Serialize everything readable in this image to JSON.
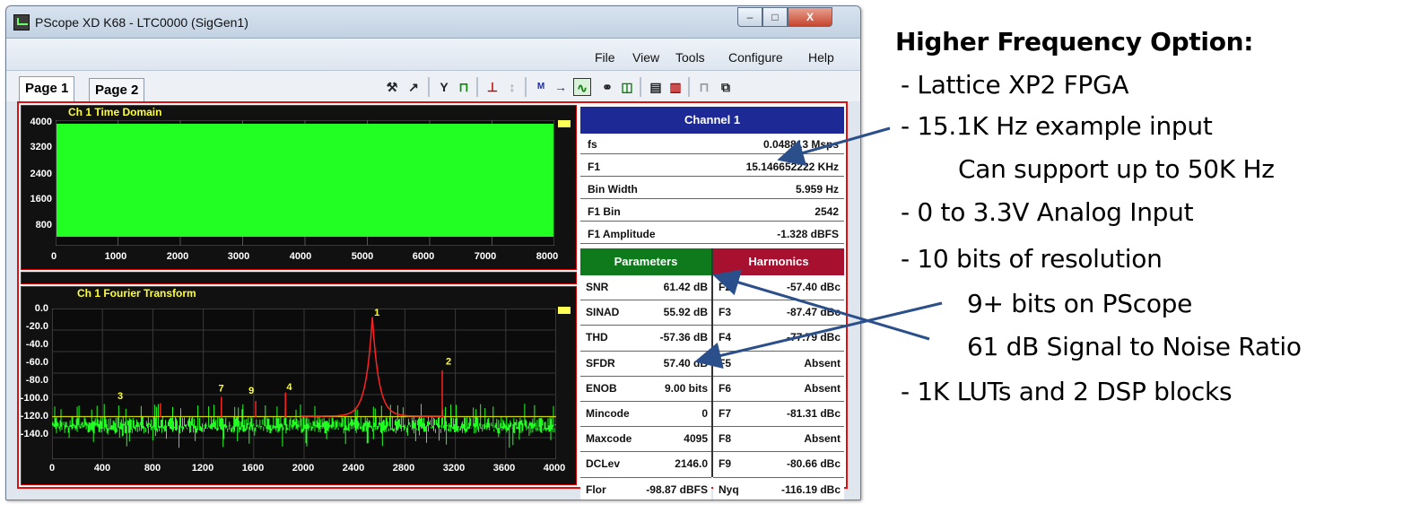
{
  "window": {
    "title": "PScope XD K68 - LTC0000 (SigGen1)",
    "min_glyph": "–",
    "max_glyph": "□",
    "close_glyph": "X"
  },
  "menu": [
    "File",
    "View",
    "Tools",
    "Configure",
    "Help"
  ],
  "tabs": [
    "Page 1",
    "Page 2"
  ],
  "toolbar_icons": [
    "wand-icon",
    "cursor-icon",
    "filter-icon",
    "pulse-icon",
    "bars-icon",
    "bars-disabled-icon",
    "avg-icon",
    "avg-arrow-icon",
    "capture-icon",
    "link-icon",
    "chart-icon",
    "save-icon",
    "print-icon",
    "square-wave-icon",
    "export-icon"
  ],
  "time_plot": {
    "title": "Ch 1 Time Domain",
    "y_ticks": [
      "4000",
      "3200",
      "2400",
      "1600",
      "800"
    ],
    "x_ticks": [
      "0",
      "1000",
      "2000",
      "3000",
      "4000",
      "5000",
      "6000",
      "7000",
      "8000"
    ],
    "trace_color": "#22ff22"
  },
  "fft_plot": {
    "title": "Ch 1 Fourier Transform",
    "y_ticks": [
      "0.0",
      "-20.0",
      "-40.0",
      "-60.0",
      "-80.0",
      "-100.0",
      "-120.0",
      "-140.0"
    ],
    "x_ticks": [
      "0",
      "400",
      "800",
      "1200",
      "1600",
      "2000",
      "2400",
      "2800",
      "3200",
      "3600",
      "4000"
    ],
    "harmonic_labels": [
      "1",
      "2",
      "3",
      "7",
      "9",
      "4"
    ],
    "trace_color": "#22ff22",
    "harmonic_color": "#ff2222"
  },
  "channel": {
    "header": "Channel 1",
    "rows": [
      {
        "label": "fs",
        "value": "0.048813 Msps"
      },
      {
        "label": "F1",
        "value": "15.146652222 KHz"
      },
      {
        "label": "Bin Width",
        "value": "5.959 Hz"
      },
      {
        "label": "F1 Bin",
        "value": "2542"
      },
      {
        "label": "F1 Amplitude",
        "value": "-1.328 dBFS"
      }
    ]
  },
  "parameters": {
    "header": "Parameters",
    "rows": [
      {
        "label": "SNR",
        "value": "61.42 dB"
      },
      {
        "label": "SINAD",
        "value": "55.92 dB"
      },
      {
        "label": "THD",
        "value": "-57.36 dB"
      },
      {
        "label": "SFDR",
        "value": "57.40 dB"
      },
      {
        "label": "ENOB",
        "value": "9.00 bits"
      },
      {
        "label": "Mincode",
        "value": "0"
      },
      {
        "label": "Maxcode",
        "value": "4095"
      },
      {
        "label": "DCLev",
        "value": "2146.0"
      },
      {
        "label": "Flor",
        "value": "-98.87 dBFS"
      }
    ]
  },
  "harmonics": {
    "header": "Harmonics",
    "rows": [
      {
        "label": "F2",
        "value": "-57.40 dBc"
      },
      {
        "label": "F3",
        "value": "-87.47 dBc"
      },
      {
        "label": "F4",
        "value": "-77.79 dBc"
      },
      {
        "label": "F5",
        "value": "Absent"
      },
      {
        "label": "F6",
        "value": "Absent"
      },
      {
        "label": "F7",
        "value": "-81.31 dBc"
      },
      {
        "label": "F8",
        "value": "Absent"
      },
      {
        "label": "F9",
        "value": "-80.66 dBc"
      },
      {
        "label": "Nyq",
        "value": "-116.19 dBc"
      }
    ]
  },
  "annotation": {
    "title": "Higher Frequency Option:",
    "lines": [
      " - Lattice XP2 FPGA",
      " - 15.1K Hz example input",
      "Can support up to 50K Hz",
      " - 0 to 3.3V Analog Input",
      " - 10 bits of resolution",
      "9+ bits on PScope",
      "61 dB Signal to Noise Ratio",
      " - 1K LUTs and 2 DSP blocks"
    ],
    "arrow_color": "#2b4f8a"
  }
}
